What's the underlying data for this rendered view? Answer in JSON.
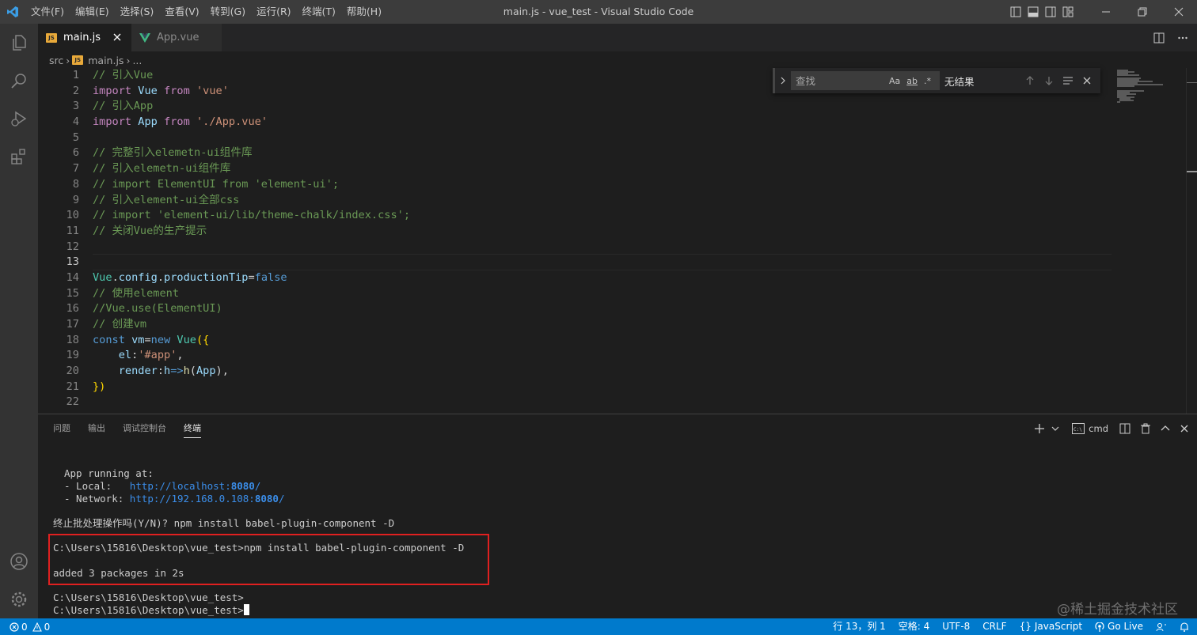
{
  "window": {
    "title": "main.js - vue_test - Visual Studio Code",
    "menus": [
      "文件(F)",
      "编辑(E)",
      "选择(S)",
      "查看(V)",
      "转到(G)",
      "运行(R)",
      "终端(T)",
      "帮助(H)"
    ]
  },
  "tabs": [
    {
      "label": "main.js",
      "icon": "js-file-icon",
      "active": true
    },
    {
      "label": "App.vue",
      "icon": "vue-file-icon",
      "active": false
    }
  ],
  "js_badge": "JS",
  "breadcrumb": {
    "folder": "src",
    "file": "main.js",
    "more": "..."
  },
  "editor": {
    "line_numbers": [
      "1",
      "2",
      "3",
      "4",
      "5",
      "6",
      "7",
      "8",
      "9",
      "10",
      "11",
      "12",
      "13",
      "14",
      "15",
      "16",
      "17",
      "18",
      "19",
      "20",
      "21",
      "22"
    ],
    "active_line": 13,
    "code_text": {
      "l1": "// 引入Vue",
      "l2_import": "import",
      "l2_vue": "Vue",
      "l2_from": "from",
      "l2_str": "'vue'",
      "l3": "// 引入App",
      "l4_import": "import",
      "l4_app": "App",
      "l4_from": "from",
      "l4_str": "'./App.vue'",
      "l6": "// 完整引入elemetn-ui组件库",
      "l7": "// 引入elemetn-ui组件库",
      "l8": "// import ElementUI from 'element-ui';",
      "l9": "// 引入element-ui全部css",
      "l10": "// import 'element-ui/lib/theme-chalk/index.css';",
      "l11": "// 关闭Vue的生产提示",
      "l14_vue": "Vue",
      "l14_config": "config",
      "l14_tip": "productionTip",
      "l14_eq": "=",
      "l14_false": "false",
      "l15": "// 使用element",
      "l16": "//Vue.use(ElementUI)",
      "l17": "// 创建vm",
      "l18_const": "const",
      "l18_vm": "vm",
      "l18_eq": "=",
      "l18_new": "new",
      "l18_vue": "Vue",
      "l18_open": "({",
      "l19_el": "el",
      "l19_colon": ":",
      "l19_str": "'#app'",
      "l19_comma": ",",
      "l20_render": "render",
      "l20_colon": ":",
      "l20_h": "h",
      "l20_arrow": "=>",
      "l20_hfn": "h",
      "l20_paren": "(",
      "l20_app": "App",
      "l20_close": "),",
      "l21": "})"
    }
  },
  "find": {
    "placeholder": "查找",
    "opt_case": "Aa",
    "opt_word": "ab",
    "opt_regex": ".*",
    "result": "无结果"
  },
  "panel": {
    "tabs": [
      "问题",
      "输出",
      "调试控制台",
      "终端"
    ],
    "active_tab": "终端",
    "shell": "cmd",
    "terminal": {
      "l1": "App running at:",
      "l2_label": "- Local:   ",
      "l2_url_pre": "http://localhost:",
      "l2_port": "8080",
      "l2_url_post": "/",
      "l3_label": "- Network: ",
      "l3_url_pre": "http://192.168.0.108:",
      "l3_port": "8080",
      "l3_url_post": "/",
      "l4": "终止批处理操作吗(Y/N)? npm install babel-plugin-component -D",
      "l5": "C:\\Users\\15816\\Desktop\\vue_test>npm install babel-plugin-component -D",
      "l6": "added 3 packages in 2s",
      "l7": "C:\\Users\\15816\\Desktop\\vue_test>",
      "l8": "C:\\Users\\15816\\Desktop\\vue_test>"
    }
  },
  "statusbar": {
    "errors": "0",
    "warnings": "0",
    "position": "行 13，列 1",
    "spaces": "空格: 4",
    "encoding": "UTF-8",
    "eol": "CRLF",
    "language": "JavaScript",
    "golive": "Go Live"
  },
  "watermark": "@稀土掘金技术社区",
  "colors": {
    "accent": "#007acc",
    "highlight": "#e02020",
    "titlebar": "#3c3c3c",
    "activitybar": "#333333"
  }
}
